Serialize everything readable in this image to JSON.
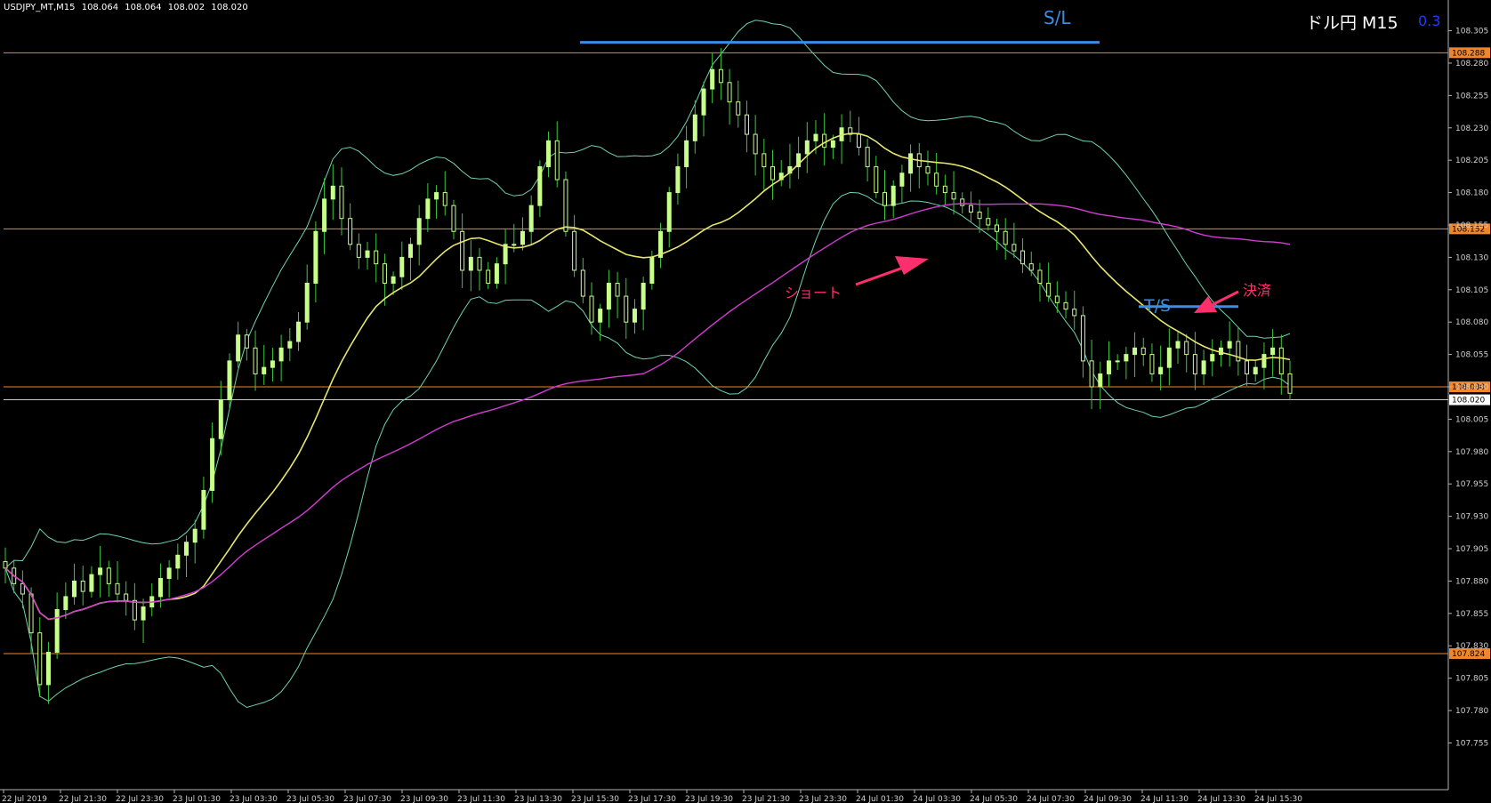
{
  "header": {
    "symbol": "USDJPY_MT,M15",
    "open": "108.064",
    "high": "108.064",
    "low": "108.002",
    "close": "108.020"
  },
  "title": "ドル円 M15",
  "spread": "0.3",
  "annotations": {
    "sl": "S/L",
    "ts": "T/S",
    "short": "ショート",
    "settle": "決済"
  },
  "colors": {
    "background": "#000000",
    "candle": "#c8ff8a",
    "wick": "#3cc83c",
    "bollinger": "#6fd3b0",
    "ma_short": "#e6e66e",
    "ma_long": "#d23cd2",
    "level_line": "#f0862c",
    "current_price_line": "#c8c8c8",
    "sl_ts_line": "#3a8ce6",
    "arrow": "#ff2f6e"
  },
  "chart_data": {
    "type": "candlestick",
    "ylim": [
      107.745,
      108.315
    ],
    "y_ticks": [
      "108.305",
      "108.280",
      "108.255",
      "108.230",
      "108.205",
      "108.180",
      "108.155",
      "108.130",
      "108.105",
      "108.080",
      "108.055",
      "108.030",
      "108.005",
      "107.980",
      "107.955",
      "107.930",
      "107.905",
      "107.880",
      "107.855",
      "107.830",
      "107.805",
      "107.780",
      "107.755"
    ],
    "x_ticks": [
      "22 Jul 2019",
      "22 Jul 21:30",
      "22 Jul 23:30",
      "23 Jul 01:30",
      "23 Jul 03:30",
      "23 Jul 05:30",
      "23 Jul 07:30",
      "23 Jul 09:30",
      "23 Jul 11:30",
      "23 Jul 13:30",
      "23 Jul 15:30",
      "23 Jul 17:30",
      "23 Jul 19:30",
      "23 Jul 21:30",
      "23 Jul 23:30",
      "24 Jul 01:30",
      "24 Jul 03:30",
      "24 Jul 05:30",
      "24 Jul 07:30",
      "24 Jul 09:30",
      "24 Jul 11:30",
      "24 Jul 13:30",
      "24 Jul 15:30"
    ],
    "horizontal_levels": [
      {
        "label": "108.288",
        "value": 108.288
      },
      {
        "label": "108.152",
        "value": 108.152
      },
      {
        "label": "108.030",
        "value": 108.03
      },
      {
        "label": "107.824",
        "value": 107.824
      }
    ],
    "current_price": {
      "label": "108.020",
      "value": 108.02
    },
    "sl_level": 108.296,
    "ts_level": 108.092,
    "closes": [
      107.89,
      107.878,
      107.87,
      107.84,
      107.8,
      107.825,
      107.858,
      107.868,
      107.88,
      107.872,
      107.885,
      107.89,
      107.878,
      107.87,
      107.865,
      107.85,
      107.86,
      107.868,
      107.882,
      107.89,
      107.9,
      107.91,
      107.92,
      107.95,
      107.99,
      108.02,
      108.05,
      108.07,
      108.06,
      108.04,
      108.045,
      108.05,
      108.06,
      108.065,
      108.08,
      108.11,
      108.15,
      108.175,
      108.185,
      108.16,
      108.14,
      108.13,
      108.135,
      108.125,
      108.11,
      108.115,
      108.13,
      108.14,
      108.16,
      108.175,
      108.18,
      108.17,
      108.15,
      108.12,
      108.13,
      108.12,
      108.11,
      108.125,
      108.14,
      108.14,
      108.15,
      108.17,
      108.2,
      108.22,
      108.19,
      108.15,
      108.12,
      108.1,
      108.08,
      108.09,
      108.11,
      108.1,
      108.08,
      108.09,
      108.11,
      108.13,
      108.15,
      108.18,
      108.2,
      108.22,
      108.24,
      108.26,
      108.275,
      108.265,
      108.25,
      108.24,
      108.225,
      108.21,
      108.2,
      108.19,
      108.195,
      108.2,
      108.21,
      108.22,
      108.225,
      108.215,
      108.22,
      108.23,
      108.225,
      108.215,
      108.2,
      108.18,
      108.17,
      108.185,
      108.195,
      108.21,
      108.2,
      108.195,
      108.185,
      108.18,
      108.175,
      108.17,
      108.165,
      108.16,
      108.155,
      108.15,
      108.14,
      108.135,
      108.125,
      108.12,
      108.11,
      108.1,
      108.095,
      108.09,
      108.085,
      108.05,
      108.03,
      108.04,
      108.05,
      108.05,
      108.055,
      108.06,
      108.055,
      108.04,
      108.045,
      108.06,
      108.065,
      108.055,
      108.04,
      108.05,
      108.055,
      108.06,
      108.065,
      108.05,
      108.04,
      108.045,
      108.055,
      108.06,
      108.04,
      108.025
    ]
  }
}
